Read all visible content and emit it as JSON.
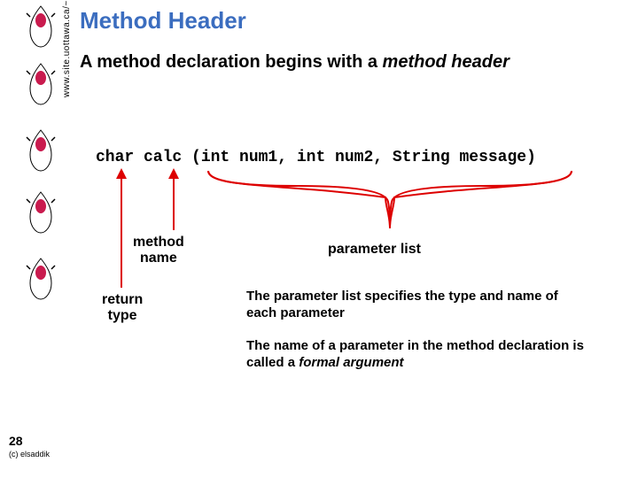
{
  "url_text": "www.site.uottawa.ca/~elsaddik",
  "title": "Method Header",
  "subtitle_prefix": "A method declaration begins with a ",
  "subtitle_italic": "method header",
  "code": "char calc (int num1, int num2, String message)",
  "labels": {
    "method_name_l1": "method",
    "method_name_l2": "name",
    "return_type_l1": "return",
    "return_type_l2": "type",
    "parameter_list": "parameter list"
  },
  "para1": "The parameter list specifies the type and name of each parameter",
  "para2_prefix": "The name of a parameter in the method declaration is called a ",
  "para2_italic": "formal argument",
  "page_number": "28",
  "copyright": "(c) elsaddik"
}
